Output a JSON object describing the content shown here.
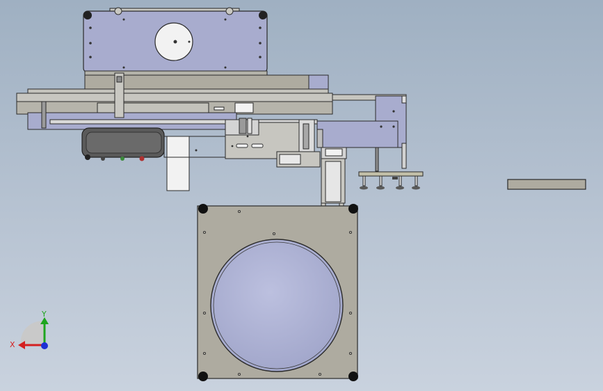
{
  "viewport": {
    "background_top": "#9fb0c2",
    "background_bottom": "#c9d2de"
  },
  "triad": {
    "x_label": "X",
    "y_label": "Y",
    "x_color": "#d42020",
    "y_color": "#1ea51e",
    "z_color": "#1e2fd4"
  },
  "palette": {
    "plate_blue": "#a8acce",
    "plate_gray": "#aeaba0",
    "plate_light": "#c7c6c0",
    "edge": "#2a2a2a",
    "white_part": "#f2f2f2",
    "dark_part": "#5a5a5a"
  }
}
